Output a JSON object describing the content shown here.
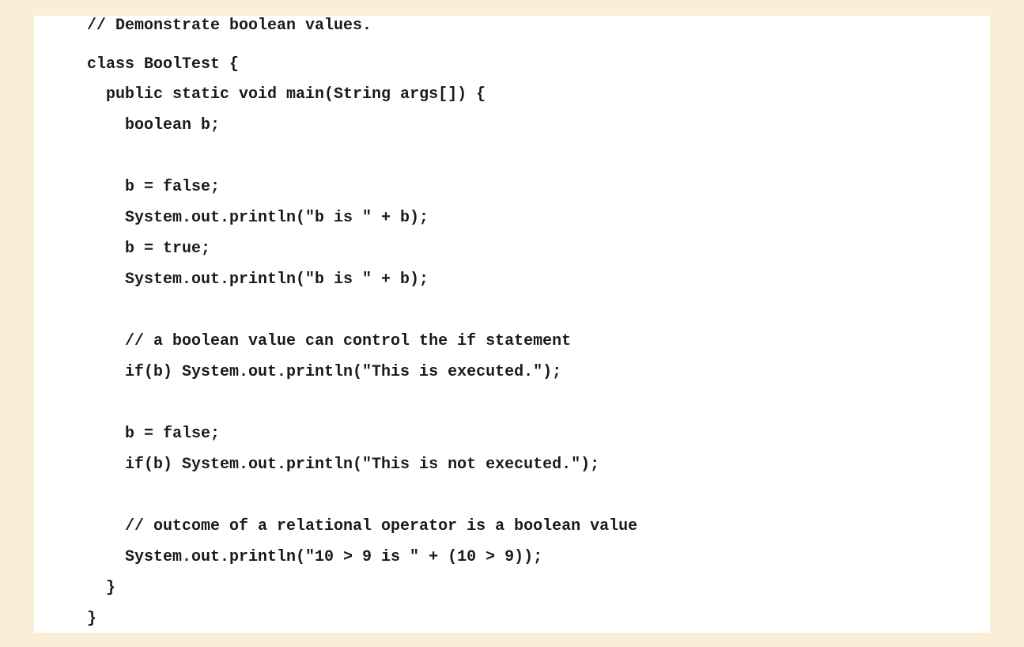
{
  "code": {
    "lines": [
      "// Demonstrate boolean values.",
      "class BoolTest {",
      "public static void main(String args[]) {",
      "boolean b;",
      "",
      "b = false;",
      "System.out.println(\"b is \" + b);",
      "b = true;",
      "System.out.println(\"b is \" + b);",
      "",
      "// a boolean value can control the if statement",
      "if(b) System.out.println(\"This is executed.\");",
      "",
      "b = false;",
      "if(b) System.out.println(\"This is not executed.\");",
      "",
      "// outcome of a relational operator is a boolean value",
      "System.out.println(\"10 > 9 is \" + (10 > 9));",
      "}",
      "}"
    ]
  }
}
